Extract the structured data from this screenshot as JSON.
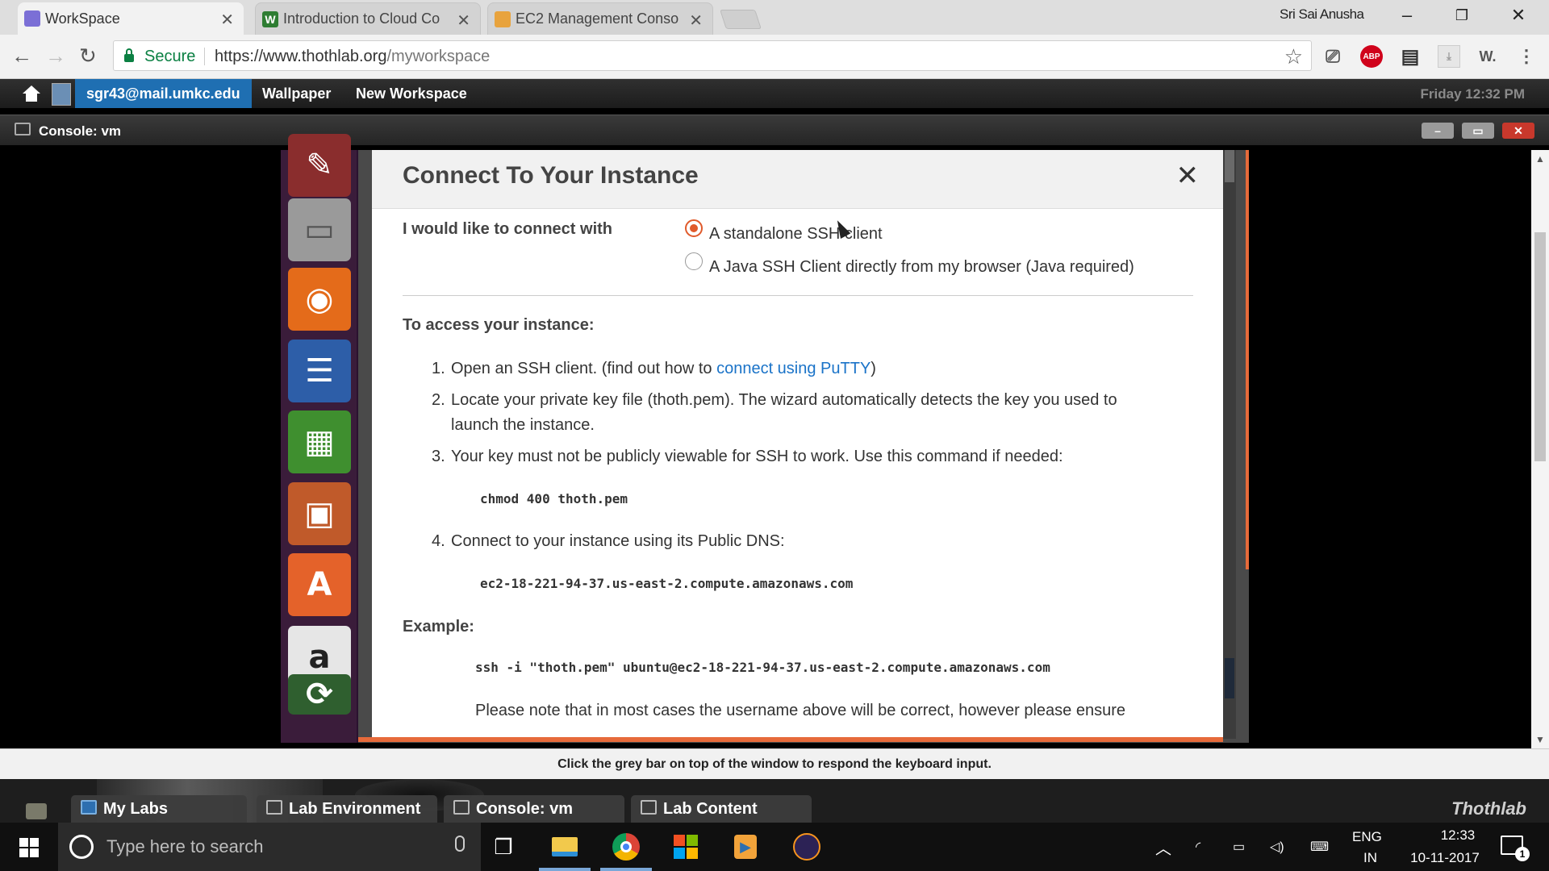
{
  "browser": {
    "tabs": [
      {
        "title": "WorkSpace",
        "favicon_color": "#7b6fd6"
      },
      {
        "title": "Introduction to Cloud Co",
        "favicon_color": "#2e7d32"
      },
      {
        "title": "EC2 Management Conso",
        "favicon_color": "#e8a33d"
      }
    ],
    "profile_name": "Sri Sai Anusha",
    "secure_label": "Secure",
    "url_host": "https://www.thothlab.org",
    "url_path": "/myworkspace",
    "extensions": [
      "cast-icon",
      "adblock-icon",
      "film-icon",
      "pdf-icon",
      "w-icon",
      "menu-icon"
    ],
    "adblock_label": "ABP",
    "w_label": "W."
  },
  "thothlab": {
    "user_email": "sgr43@mail.umkc.edu",
    "menu": [
      "Wallpaper",
      "New Workspace"
    ],
    "datetime": "Friday 12:32 PM",
    "console_title": "Console: vm",
    "hint": "Click the grey bar on top of the window to respond the keyboard input.",
    "workspace_tabs": [
      "My Labs",
      "Lab Environment",
      "Console: vm",
      "Lab Content"
    ],
    "logo": "Thothlab"
  },
  "dialog": {
    "title": "Connect To Your Instance",
    "connect_label": "I would like to connect with",
    "options": [
      {
        "label": "A standalone SSH client",
        "selected": true
      },
      {
        "label": "A Java SSH Client directly from my browser (Java required)",
        "selected": false
      }
    ],
    "access_heading": "To access your instance:",
    "step1_num": "1.",
    "step1_pre": "Open an SSH client. (find out how to ",
    "step1_link": "connect using PuTTY",
    "step1_post": ")",
    "step2_num": "2.",
    "step2_line1": "Locate your private key file (thoth.pem). The wizard automatically detects the key you used to",
    "step2_line2": "launch the instance.",
    "step3_num": "3.",
    "step3": "Your key must not be publicly viewable for SSH to work. Use this command if needed:",
    "chmod_cmd": "chmod 400 thoth.pem",
    "step4_num": "4.",
    "step4": "Connect to your instance using its Public DNS:",
    "public_dns": "ec2-18-221-94-37.us-east-2.compute.amazonaws.com",
    "example_heading": "Example:",
    "example_cmd": "ssh -i \"thoth.pem\" ubuntu@ec2-18-221-94-37.us-east-2.compute.amazonaws.com",
    "note": "Please note that in most cases the username above will be correct, however please ensure"
  },
  "dock": {
    "items": [
      "system-settings-icon",
      "files-icon",
      "firefox-icon",
      "writer-icon",
      "calc-icon",
      "impress-icon",
      "software-center-icon",
      "amazon-icon",
      "update-icon"
    ],
    "amazon_glyph": "a"
  },
  "windows": {
    "search_placeholder": "Type here to search",
    "lang_top": "ENG",
    "lang_bottom": "IN",
    "time": "12:33",
    "date": "10-11-2017",
    "notifications": "1"
  }
}
